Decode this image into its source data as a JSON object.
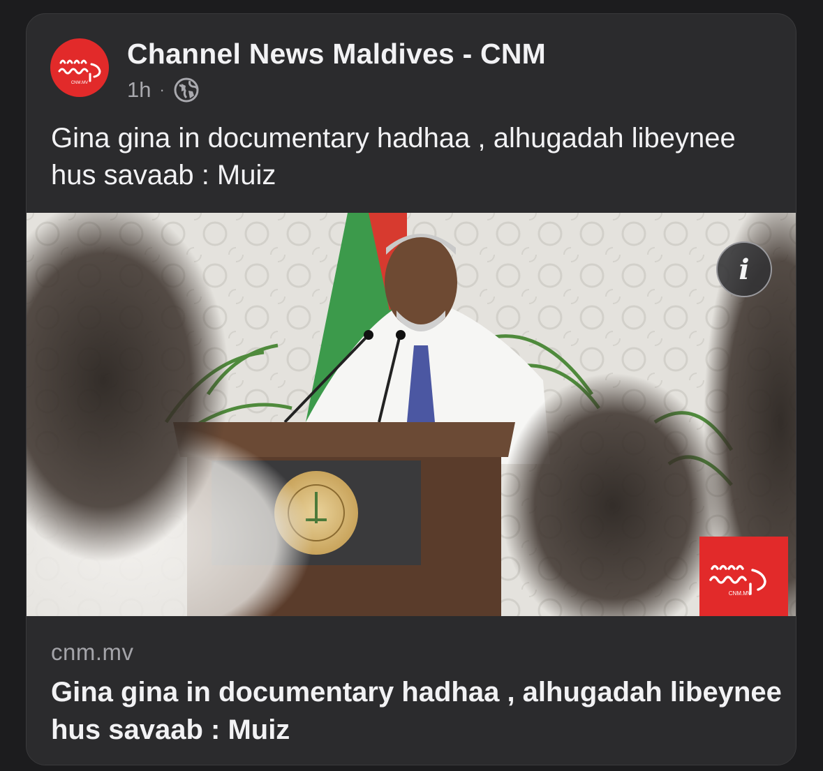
{
  "post": {
    "page_name": "Channel News Maldives - CNM",
    "time": "1h",
    "separator": "·",
    "privacy_icon": "globe-icon",
    "text": "Gina gina in documentary hadhaa , alhugadah libeynee hus savaab : Muiz",
    "avatar_logo_caption": "CNM.MV"
  },
  "image": {
    "info_icon": "info-icon",
    "info_label": "i",
    "watermark_caption": "CNM.MV"
  },
  "link": {
    "domain": "cnm.mv",
    "title": "Gina gina in documentary hadhaa , alhugadah libeynee hus savaab : Muiz"
  },
  "colors": {
    "background": "#1c1c1e",
    "card": "#2b2b2d",
    "brand_red": "#e22a2a",
    "text_primary": "#f2f2f4",
    "text_secondary": "#a9a9ae"
  }
}
